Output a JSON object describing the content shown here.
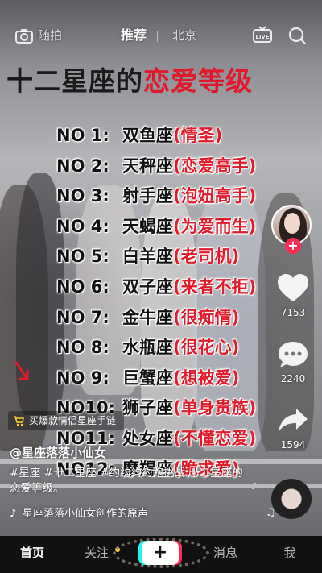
{
  "topbar": {
    "camera_label": "随拍",
    "tab_recommend": "推荐",
    "tab_local": "北京",
    "live_icon": "live-tv-icon",
    "search_icon": "search-icon"
  },
  "overlay": {
    "headline_black": "十二星座的",
    "headline_red": "恋爱等级",
    "ranks": [
      {
        "no": "NO 1:",
        "sign": "双鱼座",
        "level": "(情圣)"
      },
      {
        "no": "NO 2:",
        "sign": "天秤座",
        "level": "(恋爱高手)"
      },
      {
        "no": "NO 3:",
        "sign": "射手座",
        "level": "(泡妞高手)"
      },
      {
        "no": "NO 4:",
        "sign": "天蝎座",
        "level": "(为爱而生)"
      },
      {
        "no": "NO 5:",
        "sign": "白羊座",
        "level": "(老司机)"
      },
      {
        "no": "NO 6:",
        "sign": "双子座",
        "level": "(来者不拒)"
      },
      {
        "no": "NO 7:",
        "sign": "金牛座",
        "level": "(很痴情)"
      },
      {
        "no": "NO 8:",
        "sign": "水瓶座",
        "level": "(很花心)"
      },
      {
        "no": "NO 9:",
        "sign": "巨蟹座",
        "level": "(想被爱)"
      },
      {
        "no": "NO10:",
        "sign": "狮子座",
        "level": "(单身贵族)"
      },
      {
        "no": "NO11:",
        "sign": "处女座",
        "level": "(不懂恋爱)"
      },
      {
        "no": "NO12:",
        "sign": "摩羯座",
        "level": "(跪求爱)"
      }
    ]
  },
  "actions": {
    "likes": "7153",
    "comments": "2240",
    "shares": "1594",
    "follow_symbol": "+"
  },
  "promo": {
    "label": "买爆款情侣星座手链",
    "icon": "cart-icon"
  },
  "caption": {
    "author": "@星座落落小仙女",
    "description": "#星座 #十二星座 #约约约约跑挑战 十二星座的恋爱等级。",
    "music": "星座落落小仙女创作的原声"
  },
  "navbar": {
    "home": "首页",
    "follow": "关注",
    "plus": "+",
    "messages": "消息",
    "me": "我"
  },
  "colors": {
    "accent_red": "#e11b2b",
    "brand_pink": "#fe2c55",
    "brand_cyan": "#25f4ee",
    "dot_yellow": "#ffcf33"
  }
}
